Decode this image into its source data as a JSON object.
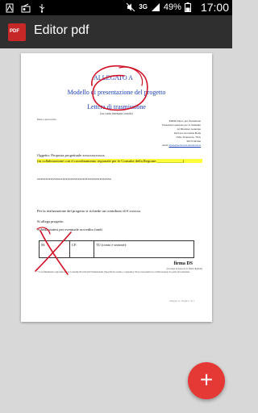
{
  "status_bar": {
    "network": "3G",
    "battery": "49%",
    "time": "17:00"
  },
  "app_bar": {
    "icon_label": "PDF",
    "title": "Editor pdf"
  },
  "document": {
    "allegato": "ALLEGATO A",
    "title": "Modello di presentazione del progetto",
    "lettera": "Lettera di trasmissione",
    "carta": "(su carta intestata scuola)",
    "prot": "Data e protocollo",
    "recipient_lines": [
      "MIUR Dip.to per l'Istruzione",
      "Direzione Generale per lo Studente",
      "Al Direttore Generale",
      "Dott.ssa Giovanna Boda",
      "Viale Trastevere, 76/A",
      "00153 Roma"
    ],
    "mail_label": "mail:",
    "mail_value": "dgsip@postacert.istruzione.it",
    "oggetto": "Oggetto: Proposta progettuale xxxxxxxxxxxx",
    "collab": "(in collaborazione con il coordinamento regionale per le Consulte della Regione:______________)",
    "xline": "xxxxxxxxxxxxxxxxxxxxxxxxxxxxxxxxxxxxxxxxxxxx",
    "contributo": "Per la realizzazione del progetto si richiede un contributo di € xxxxxx.",
    "si_allega": "Si allega progetto.",
    "scheda": "Scheda sintesi per eventuale accredito fondi",
    "table": {
      "col_m": "M:",
      "col_cf": "CF:",
      "col_tu": "TU (conto e sezione):"
    },
    "firma": "firma DS",
    "firma_sub": "(si prega di apporre la firma digitale)",
    "note": "* Coordinamento regionale per le Consulte Provinciali Studentesche (Specificare nome e cognome). Non è necessaria la collaborazione da parte del referente.",
    "footer": "Allegato A - Pagina 1 di 1"
  },
  "fab": {
    "label": "+"
  },
  "colors": {
    "app_bar": "#2f2f2f",
    "fab": "#e53935",
    "ink": "#d01025",
    "doc_blue": "#1a3fb5",
    "highlight": "#ffff3a"
  }
}
